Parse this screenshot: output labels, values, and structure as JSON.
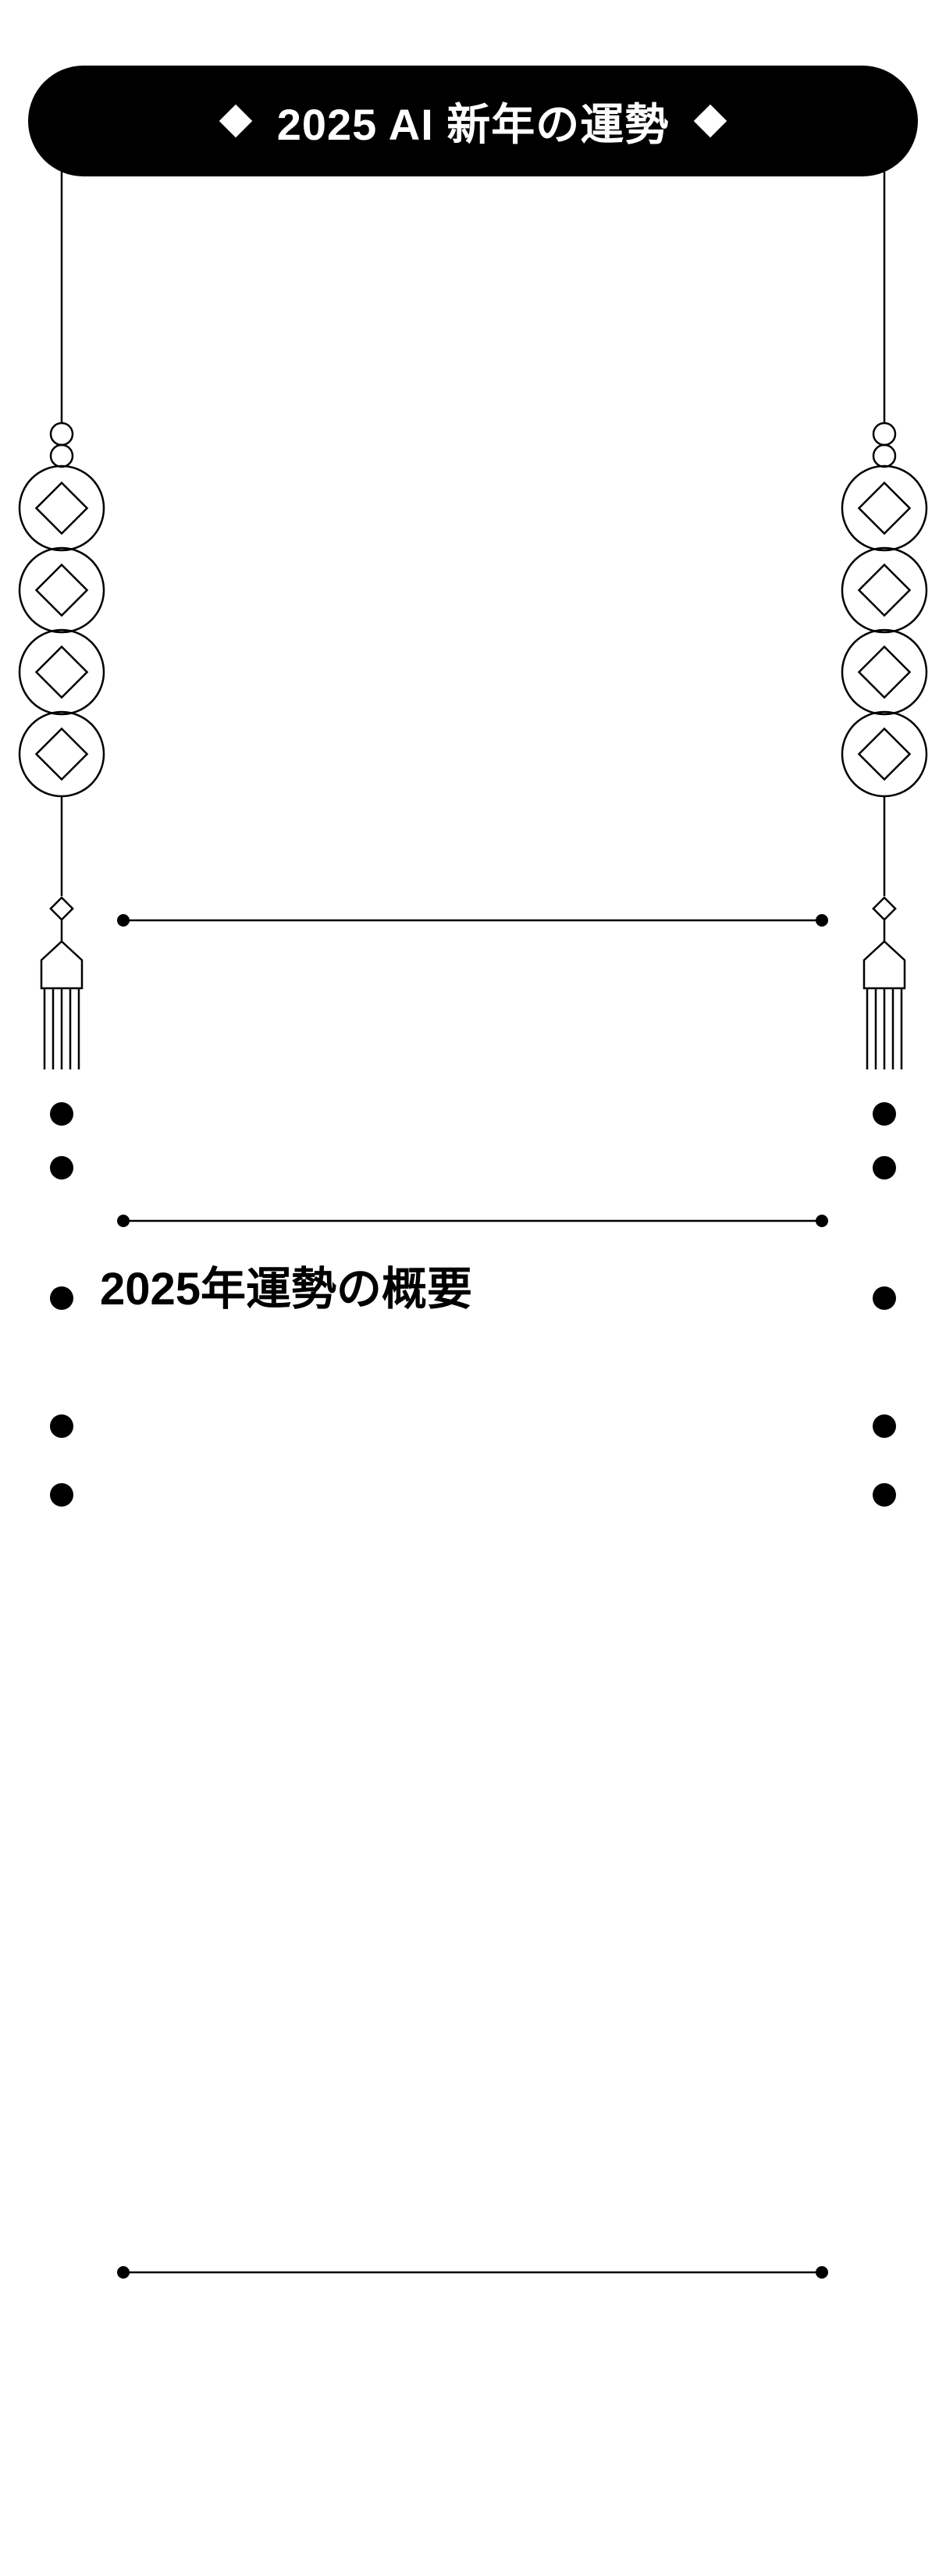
{
  "header": {
    "title": "2025 AI 新年の運勢",
    "left_ornament_icon": "diamond-icon",
    "right_ornament_icon": "diamond-icon"
  },
  "summary_section": {
    "title": "2025年運勢の概要"
  },
  "colors": {
    "ink": "#000000",
    "paper": "#ffffff"
  }
}
